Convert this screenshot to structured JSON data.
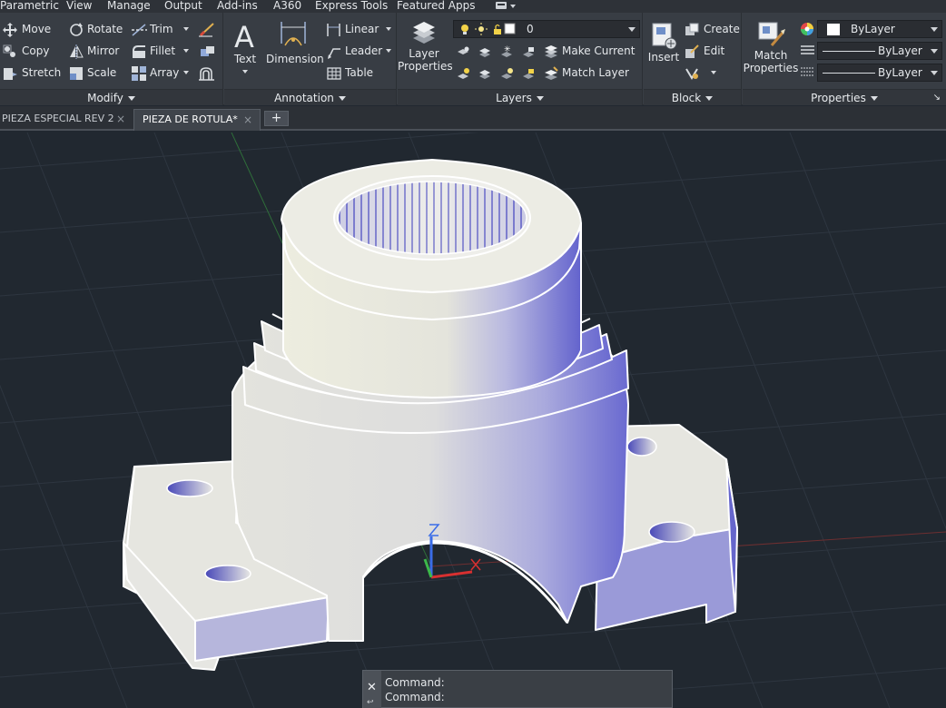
{
  "menu": {
    "tabs": [
      "Parametric",
      "View",
      "Manage",
      "Output",
      "Add-ins",
      "A360",
      "Express Tools",
      "Featured Apps"
    ]
  },
  "ribbon": {
    "modify": {
      "title": "Modify",
      "move": "Move",
      "rotate": "Rotate",
      "trim": "Trim",
      "copy": "Copy",
      "mirror": "Mirror",
      "fillet": "Fillet",
      "stretch": "Stretch",
      "scale": "Scale",
      "array": "Array"
    },
    "annotation": {
      "title": "Annotation",
      "text": "Text",
      "dimension": "Dimension",
      "linear": "Linear",
      "leader": "Leader",
      "table": "Table"
    },
    "layers": {
      "title": "Layers",
      "layer_properties_line1": "Layer",
      "layer_properties_line2": "Properties",
      "current_layer": "0",
      "make_current": "Make Current",
      "match_layer": "Match Layer"
    },
    "block": {
      "title": "Block",
      "insert": "Insert",
      "create": "Create",
      "edit": "Edit"
    },
    "properties": {
      "title": "Properties",
      "match_line1": "Match",
      "match_line2": "Properties",
      "color": "ByLayer",
      "linetype": "ByLayer",
      "lineweight": "ByLayer"
    }
  },
  "documents": {
    "tabs": [
      {
        "label": "PIEZA ESPECIAL REV 2",
        "active": false
      },
      {
        "label": "PIEZA DE ROTULA*",
        "active": true
      }
    ]
  },
  "viewport": {
    "ucs_z_label": "Z",
    "background": "#212830",
    "model_fill": "#ecece0",
    "model_shadow": "#6c6cd0"
  },
  "command_line": {
    "lines": [
      "Command:",
      "Command:"
    ]
  }
}
